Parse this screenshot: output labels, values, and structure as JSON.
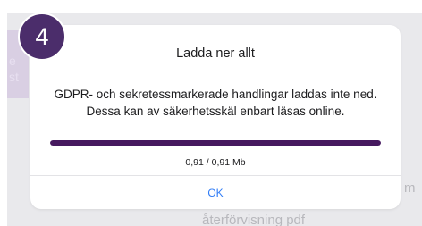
{
  "background": {
    "left_fragment_1": "e",
    "left_fragment_2": "st",
    "bottom_fragment": "återförvisning pdf",
    "right_fragment": "m"
  },
  "step_badge": {
    "number": "4",
    "color": "#4b2d6b"
  },
  "dialog": {
    "title": "Ladda ner allt",
    "message_line1": "GDPR- och sekretessmarkerade handlingar laddas inte ned.",
    "message_line2": "Dessa kan av säkerhetsskäl enbart läsas online.",
    "progress": {
      "fraction": 1.0,
      "text": "0,91 / 0,91 Mb",
      "fill_color": "#46195f"
    },
    "ok_label": "OK",
    "ok_color": "#2f7cf6"
  }
}
